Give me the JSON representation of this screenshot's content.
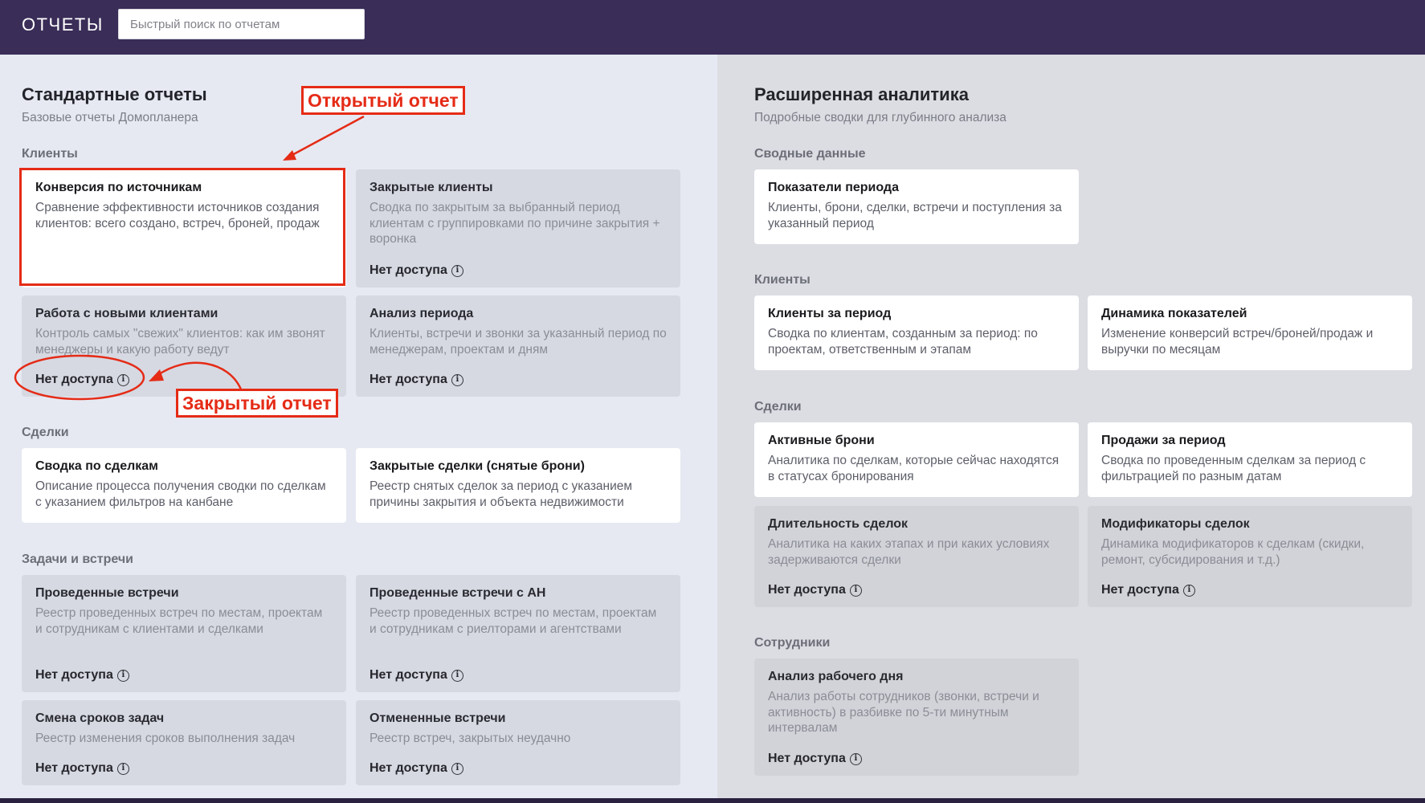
{
  "header": {
    "title": "ОТЧЕТЫ",
    "search_placeholder": "Быстрый поиск по отчетам"
  },
  "standard": {
    "title": "Стандартные отчеты",
    "subtitle": "Базовые отчеты Домопланера",
    "groups": {
      "clients": "Клиенты",
      "deals": "Сделки",
      "tasks": "Задачи и встречи"
    },
    "cards": [
      {
        "title": "Конверсия по источникам",
        "desc": "Сравнение эффективности источников создания клиентов: всего создано, встреч, броней, продаж"
      },
      {
        "title": "Закрытые клиенты",
        "desc": "Сводка по закрытым за выбранный период клиентам с группировками по причине закрытия + воронка"
      },
      {
        "title": "Работа с новыми клиентами",
        "desc": "Контроль самых \"свежих\" клиентов: как им звонят менеджеры и какую работу ведут"
      },
      {
        "title": "Анализ периода",
        "desc": "Клиенты, встречи и звонки за указанный период по менеджерам, проектам и дням"
      },
      {
        "title": "Сводка по сделкам",
        "desc": "Описание процесса получения сводки по сделкам с указанием фильтров на канбане"
      },
      {
        "title": "Закрытые сделки (снятые брони)",
        "desc": "Реестр снятых сделок за период с указанием причины закрытия и объекта недвижимости"
      },
      {
        "title": "Проведенные встречи",
        "desc": "Реестр проведенных встреч по местам, проектам и сотрудникам с клиентами и сделками"
      },
      {
        "title": "Проведенные встречи с АН",
        "desc": "Реестр проведенных встреч по местам, проектам и сотрудникам с риелторами и агентствами"
      },
      {
        "title": "Смена сроков задач",
        "desc": "Реестр изменения сроков выполнения задач"
      },
      {
        "title": "Отмененные встречи",
        "desc": "Реестр встреч, закрытых неудачно"
      }
    ]
  },
  "advanced": {
    "title": "Расширенная аналитика",
    "subtitle": "Подробные сводки для глубинного анализа",
    "groups": {
      "summary": "Сводные данные",
      "clients": "Клиенты",
      "deals": "Сделки",
      "staff": "Сотрудники"
    },
    "cards": [
      {
        "title": "Показатели периода",
        "desc": "Клиенты, брони, сделки, встречи и поступления за указанный период"
      },
      {
        "title": "Клиенты за период",
        "desc": "Сводка по клиентам, созданным за период: по проектам, ответственным и этапам"
      },
      {
        "title": "Динамика показателей",
        "desc": "Изменение конверсий встреч/броней/продаж и выручки по месяцам"
      },
      {
        "title": "Активные брони",
        "desc": "Аналитика по сделкам, которые сейчас находятся в статусах бронирования"
      },
      {
        "title": "Продажи за период",
        "desc": "Сводка по проведенным сделкам за период с фильтрацией по разным датам"
      },
      {
        "title": "Длительность сделок",
        "desc": "Аналитика на каких этапах и при каких условиях задерживаются сделки"
      },
      {
        "title": "Модификаторы сделок",
        "desc": "Динамика модификаторов к сделкам (скидки, ремонт, субсидирования и т.д.)"
      },
      {
        "title": "Анализ рабочего дня",
        "desc": "Анализ работы сотрудников (звонки, встречи и активность) в разбивке по 5-ти минутным интервалам"
      }
    ]
  },
  "no_access_label": "Нет доступа",
  "info_glyph": "i",
  "annotations": {
    "opened": "Открытый отчет",
    "closed": "Закрытый отчет",
    "color": "#e52b16"
  },
  "colors": {
    "topbar": "#3a2d58",
    "left_bg": "#e6e9f2",
    "right_bg": "#dcdde3"
  }
}
